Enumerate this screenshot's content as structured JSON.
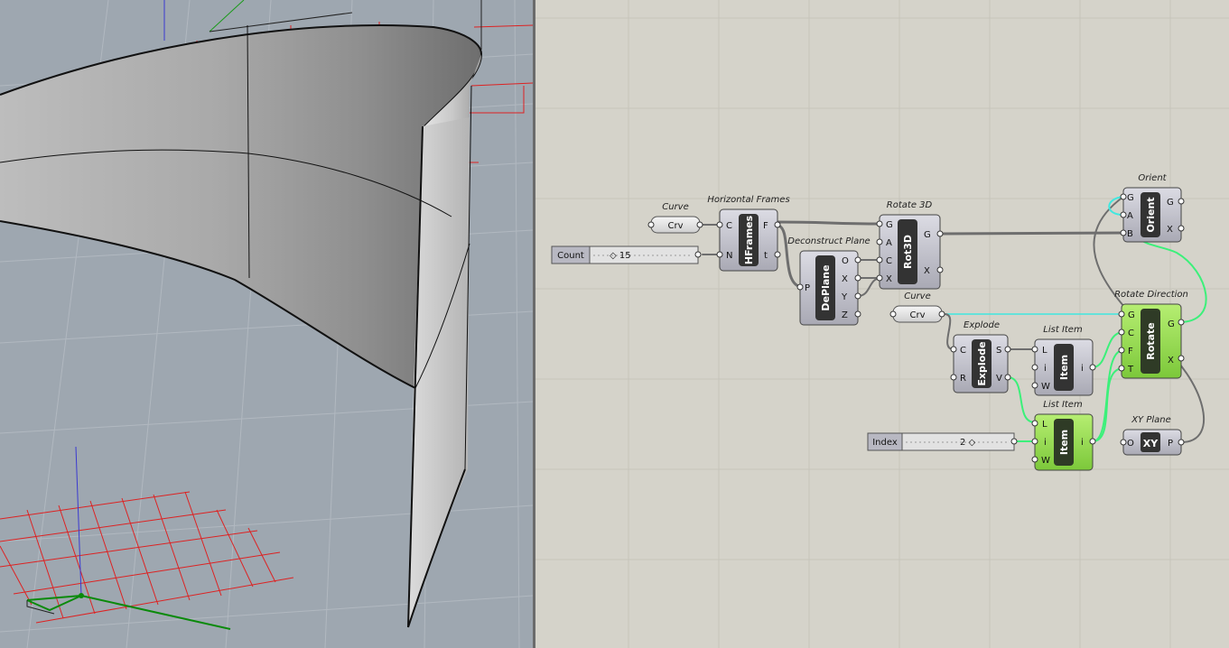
{
  "components": {
    "curve1": {
      "title": "Curve",
      "label": "Crv"
    },
    "count": {
      "label": "Count",
      "value": "◇ 15"
    },
    "hframes": {
      "title": "Horizontal Frames",
      "name": "HFrames",
      "inputs": [
        "C",
        "N"
      ],
      "outputs": [
        "F",
        "t"
      ]
    },
    "deplane": {
      "title": "Deconstruct Plane",
      "name": "DePlane",
      "inputs": [
        "P"
      ],
      "outputs": [
        "O",
        "X",
        "Y",
        "Z"
      ]
    },
    "rot3d": {
      "title": "Rotate 3D",
      "name": "Rot3D",
      "inputs": [
        "G",
        "A",
        "C",
        "X"
      ],
      "outputs": [
        "G",
        "X"
      ]
    },
    "orient": {
      "title": "Orient",
      "name": "Orient",
      "inputs": [
        "G",
        "A",
        "B"
      ],
      "outputs": [
        "G",
        "X"
      ]
    },
    "curve2": {
      "title": "Curve",
      "label": "Crv"
    },
    "explode": {
      "title": "Explode",
      "name": "Explode",
      "inputs": [
        "C",
        "R"
      ],
      "outputs": [
        "S",
        "V"
      ]
    },
    "listitem1": {
      "title": "List Item",
      "name": "Item",
      "inputs": [
        "L",
        "i",
        "W"
      ],
      "outputs": [
        "i"
      ]
    },
    "rotdir": {
      "title": "Rotate Direction",
      "name": "Rotate",
      "inputs": [
        "G",
        "C",
        "F",
        "T"
      ],
      "outputs": [
        "G",
        "X"
      ]
    },
    "listitem2": {
      "title": "List Item",
      "name": "Item",
      "inputs": [
        "L",
        "i",
        "W"
      ],
      "outputs": [
        "i"
      ]
    },
    "index": {
      "label": "Index",
      "value": "2 ◇"
    },
    "xyplane": {
      "title": "XY Plane",
      "name": "XY",
      "inputs": [
        "O"
      ],
      "outputs": [
        "P"
      ]
    }
  },
  "colors": {
    "component_gray": "#b8b8c2",
    "component_green": "#8ed84a",
    "wire_gray": "#6e6e6e",
    "wire_selected": "#3cf07a",
    "wire_cyan": "#40e8e0",
    "viewport_bg": "#9ea7b0",
    "canvas_bg": "#d5d3ca"
  }
}
